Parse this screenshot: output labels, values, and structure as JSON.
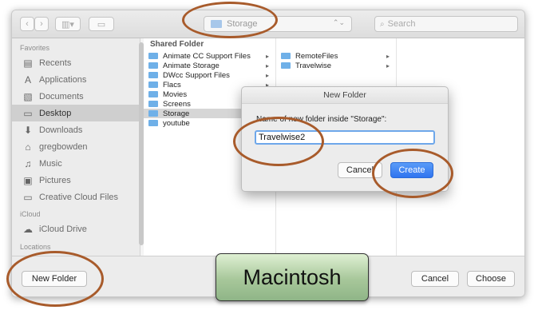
{
  "toolbar": {
    "back_label": "‹",
    "forward_label": "›",
    "view_label": "▥▾",
    "folder_label": "▭",
    "location_value": "Storage",
    "location_stepper": "⌃⌄",
    "search_icon": "⌕",
    "search_placeholder": "Search"
  },
  "sidebar": {
    "favorites_heading": "Favorites",
    "favorites": [
      {
        "label": "Recents",
        "icon": "recents-icon",
        "glyph": "▤"
      },
      {
        "label": "Applications",
        "icon": "applications-icon",
        "glyph": "A"
      },
      {
        "label": "Documents",
        "icon": "documents-icon",
        "glyph": "▧"
      },
      {
        "label": "Desktop",
        "icon": "desktop-icon",
        "glyph": "▭"
      },
      {
        "label": "Downloads",
        "icon": "downloads-icon",
        "glyph": "⬇"
      },
      {
        "label": "gregbowden",
        "icon": "home-icon",
        "glyph": "⌂"
      },
      {
        "label": "Music",
        "icon": "music-icon",
        "glyph": "♫"
      },
      {
        "label": "Pictures",
        "icon": "pictures-icon",
        "glyph": "▣"
      },
      {
        "label": "Creative Cloud Files",
        "icon": "creative-cloud-folder-icon",
        "glyph": "▭"
      }
    ],
    "icloud_heading": "iCloud",
    "icloud": [
      {
        "label": "iCloud Drive",
        "icon": "cloud-icon",
        "glyph": "☁"
      }
    ],
    "locations_heading": "Locations",
    "selected": "Desktop"
  },
  "columns": {
    "header": "Shared Folder",
    "column1": [
      {
        "label": "Animate CC Support Files",
        "has_children": true
      },
      {
        "label": "Animate Storage",
        "has_children": true
      },
      {
        "label": "DWcc Support Files",
        "has_children": true
      },
      {
        "label": "Flacs",
        "has_children": true
      },
      {
        "label": "Movies",
        "has_children": false
      },
      {
        "label": "Screens",
        "has_children": false
      },
      {
        "label": "Storage",
        "has_children": true
      },
      {
        "label": "youtube",
        "has_children": false
      }
    ],
    "column1_selected": "Storage",
    "column2": [
      {
        "label": "RemoteFiles",
        "has_children": true
      },
      {
        "label": "Travelwise",
        "has_children": true
      }
    ],
    "arrow_glyph": "▸"
  },
  "dialog": {
    "title": "New Folder",
    "prompt": "Name of new folder inside \"Storage\":",
    "input_value": "Travelwise2",
    "cancel_label": "Cancel",
    "create_label": "Create"
  },
  "bottom": {
    "new_folder_label": "New Folder",
    "cancel_label": "Cancel",
    "choose_label": "Choose"
  },
  "caption": "Macintosh",
  "colors": {
    "accent": "#3478f6",
    "highlight_oval": "#a85b2b",
    "caption_green": "#a7c79a",
    "folder_blue": "#6fb0e8"
  }
}
